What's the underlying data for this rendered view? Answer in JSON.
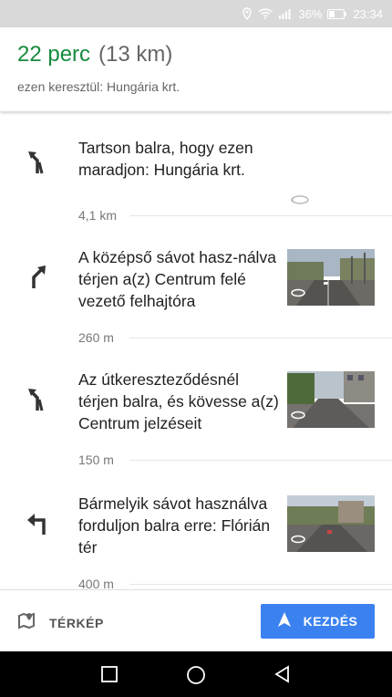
{
  "status_bar": {
    "battery_percent": "36%",
    "time": "23:34",
    "icons": [
      "location-icon",
      "wifi-icon",
      "signal-icon",
      "battery-icon"
    ]
  },
  "route_summary": {
    "duration": "22 perc",
    "distance": "(13 km)",
    "via": "ezen keresztül: Hungária krt."
  },
  "steps": [
    {
      "text": "Tartson balra, hogy ezen maradjon: Hungária krt.",
      "distance": "4,1 km",
      "icon": "keep-left-icon"
    },
    {
      "text": "A középső sávot hasz-nálva térjen a(z) Centrum felé vezető felhajtóra",
      "distance": "260 m",
      "icon": "slight-right-icon"
    },
    {
      "text": "Az útkereszteződésnél térjen balra, és kövesse a(z) Centrum jelzéseit",
      "distance": "150 m",
      "icon": "keep-left-icon"
    },
    {
      "text": "Bármelyik sávot használva forduljon balra erre: Flórián tér",
      "distance": "400 m",
      "icon": "turn-left-icon"
    }
  ],
  "bottom_bar": {
    "map_label": "TÉRKÉP",
    "start_label": "KEZDÉS",
    "accent_color": "#3b82f0"
  },
  "colors": {
    "duration": "#178a3e",
    "status_bar": "#d9d9d9"
  }
}
